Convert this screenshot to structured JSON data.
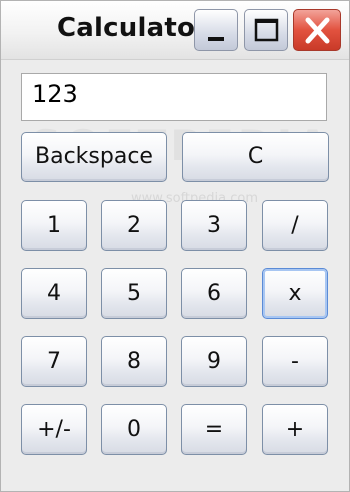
{
  "window": {
    "title": "Calculator"
  },
  "display": {
    "value": "123"
  },
  "watermark": {
    "big": "SOFTPEDIA",
    "small": "www.softpedia.com"
  },
  "buttons": {
    "backspace": "Backspace",
    "clear": "C",
    "k1": "1",
    "k2": "2",
    "k3": "3",
    "div": "/",
    "k4": "4",
    "k5": "5",
    "k6": "6",
    "mul": "x",
    "k7": "7",
    "k8": "8",
    "k9": "9",
    "sub": "-",
    "neg": "+/-",
    "k0": "0",
    "eq": "=",
    "add": "+"
  },
  "colors": {
    "close_button": "#e2523f",
    "focus_border": "#5b8bd6",
    "window_bg": "#ececec"
  },
  "icons": {
    "minimize": "minimize-icon",
    "maximize": "maximize-icon",
    "close": "close-icon"
  }
}
